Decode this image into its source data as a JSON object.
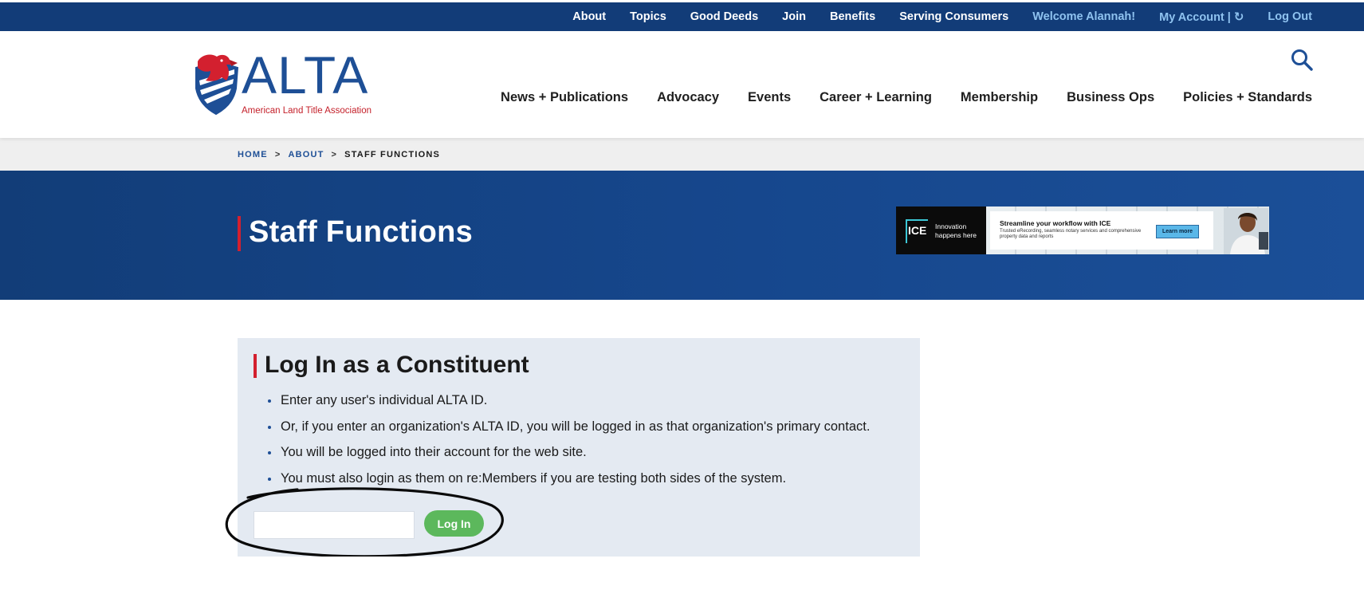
{
  "utility_nav": {
    "items": [
      {
        "label": "About",
        "tone": "white"
      },
      {
        "label": "Topics",
        "tone": "white"
      },
      {
        "label": "Good Deeds",
        "tone": "white"
      },
      {
        "label": "Join",
        "tone": "white"
      },
      {
        "label": "Benefits",
        "tone": "white"
      },
      {
        "label": "Serving Consumers",
        "tone": "white"
      },
      {
        "label": "Welcome Alannah!",
        "tone": "light"
      },
      {
        "label": "My Account |",
        "tone": "light",
        "icon": "refresh-icon"
      },
      {
        "label": "Log Out",
        "tone": "light"
      }
    ],
    "background": "#123c78"
  },
  "logo": {
    "wordmark": "ALTA",
    "tagline": "American Land Title Association",
    "brand_blue": "#1e4f96",
    "brand_red": "#c4202a"
  },
  "main_nav": {
    "items": [
      "News + Publications",
      "Advocacy",
      "Events",
      "Career + Learning",
      "Membership",
      "Business Ops",
      "Policies + Standards"
    ],
    "search_icon": "search-icon"
  },
  "breadcrumb": {
    "home": "HOME",
    "separator": ">",
    "about": "ABOUT",
    "current": "STAFF FUNCTIONS"
  },
  "hero": {
    "title": "Staff Functions",
    "accent": "#d3202f"
  },
  "ad": {
    "logo_text": "ICE",
    "tagline": "Innovation happens here",
    "headline": "Streamline your workflow with ICE",
    "subtext": "Trusted eRecording, seamless notary services and comprehensive property data and reports",
    "button_label": "Learn more"
  },
  "login_panel": {
    "title": "Log In as a Constituent",
    "instructions": [
      "Enter any user's individual ALTA ID.",
      "Or, if you enter an organization's ALTA ID, you will be logged in as that organization's primary contact.",
      "You will be logged into their account for the web site.",
      "You must also login as them on re:Members if you are testing both sides of the system."
    ],
    "input_value": "",
    "button_label": "Log In",
    "button_color": "#5cb85c"
  }
}
